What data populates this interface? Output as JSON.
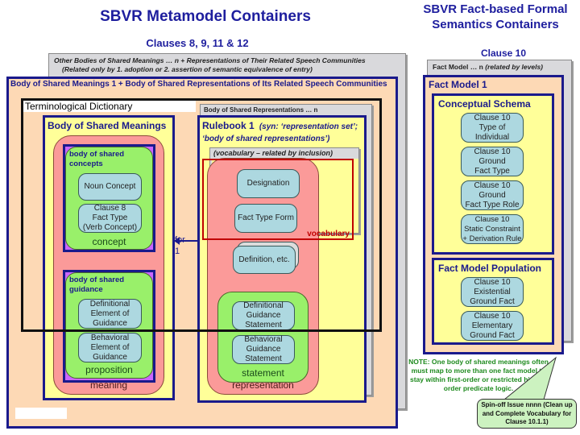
{
  "titles": {
    "main": "SBVR Metamodel Containers",
    "main_sub": "Clauses 8, 9, 11 & 12",
    "right": "SBVR Fact-based Formal Semantics Containers",
    "right_sub": "Clause 10"
  },
  "left": {
    "other_bodies_line1": "Other Bodies of Shared Meanings … n + Representations of Their Related Speech Communities",
    "other_bodies_line2": "(Related only by 1. adoption or 2. assertion of semantic equivalence of entry)",
    "body1_title": "Body of Shared Meanings 1 + Body of Shared Representations of Its Related Speech Communities",
    "terminological_dictionary": "Terminological Dictionary",
    "body_of_shared_meanings": "Body of Shared Meanings",
    "body_of_shared_concepts": "body of shared concepts",
    "noun_concept": "Noun Concept",
    "fact_type": [
      "Clause 8",
      "Fact Type",
      "(Verb Concept)"
    ],
    "concept_label": "concept",
    "body_of_shared_guidance": "body of shared guidance",
    "definitional_element": [
      "Definitional",
      "Element of",
      "Guidance"
    ],
    "behavioral_element": [
      "Behavioral",
      "Element of",
      "Guidance"
    ],
    "proposition_label": "proposition",
    "meaning_label": "meaning",
    "for_label": "for",
    "for_count": "1",
    "bsr_n": "Body of Shared Representations …  n",
    "rulebook_title": "Rulebook 1",
    "rulebook_syn": "(syn: ‘representation set’; ‘body of shared representations’)",
    "vocabulary_related": "(vocabulary – related by inclusion)",
    "designation": "Designation",
    "fact_type_form": "Fact Type Form",
    "vocabulary_label": "vocabulary",
    "definition_etc": "Definition, etc.",
    "definitional_statement": [
      "Definitional",
      "Guidance",
      "Statement"
    ],
    "behavioral_statement": [
      "Behavioral",
      "Guidance",
      "Statement"
    ],
    "statement_label": "statement",
    "representation_label": "representation"
  },
  "right": {
    "fact_model_n": "Fact Model … n",
    "fact_model_n_note": "(related by levels)",
    "fact_model_1": "Fact Model 1",
    "conceptual_schema": "Conceptual Schema",
    "schema_items": [
      [
        "Clause 10",
        "Type of",
        "Individual"
      ],
      [
        "Clause 10",
        "Ground",
        "Fact Type"
      ],
      [
        "Clause 10",
        "Ground",
        "Fact Type Role"
      ],
      [
        "Clause 10",
        "Static Constraint",
        "+ Derivation Rule"
      ]
    ],
    "fact_model_population": "Fact Model Population",
    "population_items": [
      [
        "Clause 10",
        "Existential",
        "Ground Fact"
      ],
      [
        "Clause 10",
        "Elementary",
        "Ground Fact"
      ]
    ],
    "note": "NOTE: One body of shared meanings often must map to more than one fact model to stay within first-order or restricted higher-order predicate logic.",
    "callout": "Spin-off Issue nnnn (Clean up and Complete Vocabulary for Clause 10.1.1)"
  },
  "colors": {
    "navy": "#1a1a8c",
    "peach": "#fdd9b5",
    "yellow": "#ffff99",
    "salmon": "#fb9a99",
    "green": "#99f06a",
    "cyan": "#add8e0",
    "gray": "#d9d9dc",
    "vocabulary_red": "#c00000",
    "note_green": "#1e8a1e"
  }
}
